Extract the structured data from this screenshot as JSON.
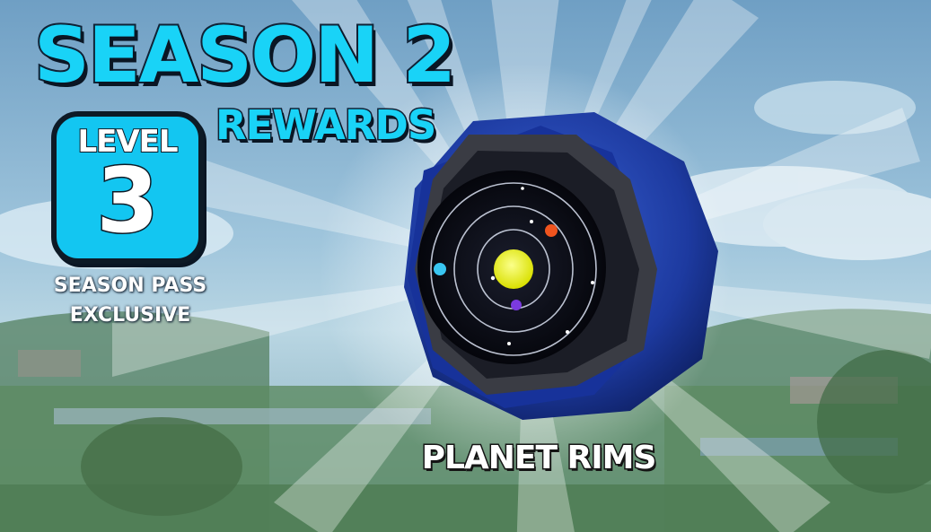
{
  "header": {
    "title": "SEASON 2",
    "subtitle": "REWARDS"
  },
  "level_badge": {
    "label": "LEVEL",
    "number": "3"
  },
  "pass_note": {
    "line1": "SEASON PASS",
    "line2": "EXCLUSIVE"
  },
  "reward": {
    "name": "PLANET RIMS"
  },
  "colors": {
    "title_cyan": "#19d3f7",
    "badge_cyan": "#13c6f1",
    "outline_dark": "#102236",
    "rim_blue": "#1f3fa6",
    "sun_yellow": "#f2f53a"
  }
}
